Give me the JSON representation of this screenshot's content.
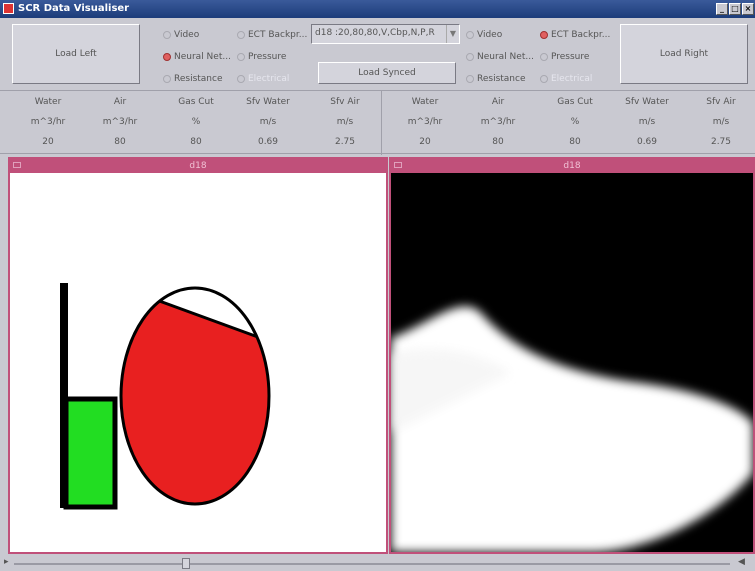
{
  "window": {
    "title": "SCR Data Visualiser"
  },
  "left_controls": {
    "load_label": "Load Left",
    "radios": [
      {
        "label": "Video",
        "state": "off"
      },
      {
        "label": "ECT Backpr...",
        "state": "off"
      },
      {
        "label": "Neural Net...",
        "state": "on"
      },
      {
        "label": "Pressure",
        "state": "off"
      },
      {
        "label": "Resistance",
        "state": "off"
      },
      {
        "label": "Electrical",
        "state": "disabled"
      }
    ]
  },
  "center_controls": {
    "dataset_value": "d18 :20,80,80,V,Cbp,N,P,R",
    "load_synced_label": "Load Synced"
  },
  "right_controls": {
    "load_label": "Load Right",
    "radios": [
      {
        "label": "Video",
        "state": "off"
      },
      {
        "label": "ECT Backpr...",
        "state": "on"
      },
      {
        "label": "Neural Net...",
        "state": "off"
      },
      {
        "label": "Pressure",
        "state": "off"
      },
      {
        "label": "Resistance",
        "state": "off"
      },
      {
        "label": "Electrical",
        "state": "disabled"
      }
    ]
  },
  "metrics_left": {
    "headers": [
      "Water",
      "Air",
      "Gas Cut",
      "Sfv Water",
      "Sfv Air"
    ],
    "units": [
      "m^3/hr",
      "m^3/hr",
      "%",
      "m/s",
      "m/s"
    ],
    "values": [
      "20",
      "80",
      "80",
      "0.69",
      "2.75"
    ]
  },
  "metrics_right": {
    "headers": [
      "Water",
      "Air",
      "Gas Cut",
      "Sfv Water",
      "Sfv Air"
    ],
    "units": [
      "m^3/hr",
      "m^3/hr",
      "%",
      "m/s",
      "m/s"
    ],
    "values": [
      "20",
      "80",
      "80",
      "0.69",
      "2.75"
    ]
  },
  "left_panel": {
    "title": "d18",
    "fill_color": "#e82020",
    "level_color": "#22dd22"
  },
  "right_panel": {
    "title": "d18"
  },
  "slider": {
    "position": 0.24
  }
}
